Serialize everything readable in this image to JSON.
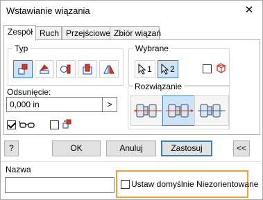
{
  "window": {
    "title": "Wstawianie wiązania",
    "close_glyph": "✕"
  },
  "tabs": [
    {
      "label": "Zespół",
      "active": true
    },
    {
      "label": "Ruch",
      "active": false
    },
    {
      "label": "Przejściowe",
      "active": false
    },
    {
      "label": "Zbiór wiązań",
      "active": false
    }
  ],
  "type_group": {
    "legend": "Typ",
    "buttons": [
      {
        "name": "mate-constraint-icon",
        "pressed": true
      },
      {
        "name": "angle-constraint-icon",
        "pressed": false
      },
      {
        "name": "tangent-constraint-icon",
        "pressed": false
      },
      {
        "name": "insert-constraint-icon",
        "pressed": false
      },
      {
        "name": "symmetry-constraint-icon",
        "pressed": false
      }
    ]
  },
  "selections_group": {
    "legend": "Wybrane",
    "select1_label": "1",
    "select2_label": "2",
    "select2_pressed": true,
    "pick_part_first_checked": false
  },
  "offset": {
    "label": "Odsunięcie:",
    "value": "0,000 in",
    "arrow_glyph": ">"
  },
  "show_preview_checked": true,
  "predict_offset_checked": false,
  "solution_group": {
    "legend": "Rozwiązanie",
    "options": [
      {
        "name": "solution-mate-icon",
        "pressed": false
      },
      {
        "name": "solution-flush-icon",
        "pressed": true
      },
      {
        "name": "solution-undirected-icon",
        "pressed": false
      }
    ]
  },
  "footer": {
    "help_glyph": "?",
    "ok_label": "OK",
    "cancel_label": "Anuluj",
    "apply_label": "Zastosuj",
    "collapse_label": "<<"
  },
  "name_section": {
    "label": "Nazwa",
    "value": "",
    "default_undirected_label": "Ustaw domyślnie Niezorientowane",
    "default_undirected_checked": false
  },
  "colors": {
    "accent": "#3c7fb1",
    "highlight": "#f0a030",
    "part_red": "#d23a2c",
    "part_blue": "#2a62c9"
  }
}
